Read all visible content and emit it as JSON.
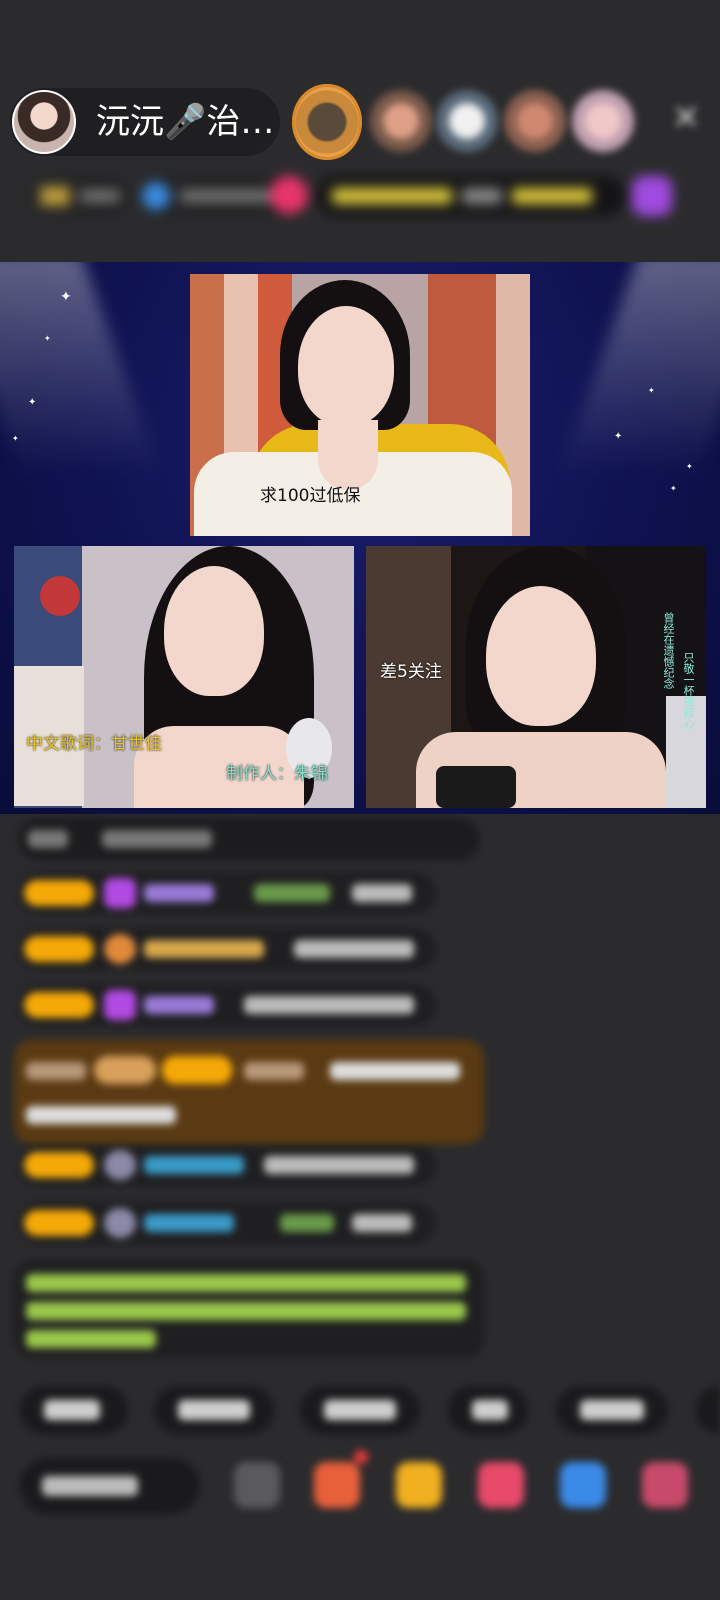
{
  "header": {
    "host_name": "沅沅🎤治…",
    "close_glyph": "✕"
  },
  "stage": {
    "top_video": {
      "caption": "求100过低保"
    },
    "left_video": {
      "lyrics_label": "中文歌词：甘世佳",
      "producer_label": "制作人：朱锦"
    },
    "right_video": {
      "caption": "差5关注",
      "vertical_text_1": "曾经在遗憾纪念",
      "vertical_text_2": "只敬一杯孤寂心"
    }
  },
  "colors": {
    "badge": "#f5a908",
    "stage_bg": "#0f1250",
    "chat_bg": "#1f1f21",
    "highlight": "#5a3a12",
    "purple_gem": "#b04ae0",
    "yellow_caption": "#e6c427"
  },
  "icons": {
    "close": "close-icon",
    "star": "star-icon",
    "gem": "gem-icon",
    "gift": "gift-icon",
    "emoji": "emoji-icon"
  }
}
